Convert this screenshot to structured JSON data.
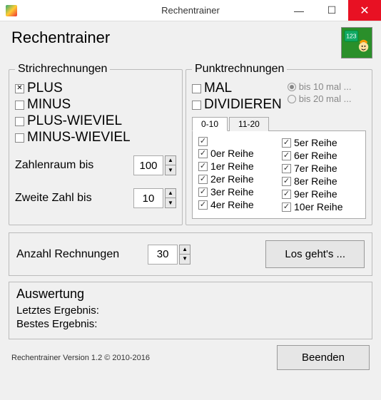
{
  "window": {
    "title": "Rechentrainer"
  },
  "header": {
    "title": "Rechentrainer"
  },
  "strich": {
    "legend": "Strichrechnungen",
    "items": [
      {
        "label": "PLUS",
        "checked": true
      },
      {
        "label": "MINUS",
        "checked": false
      },
      {
        "label": "PLUS-WIEVIEL",
        "checked": false
      },
      {
        "label": "MINUS-WIEVIEL",
        "checked": false
      }
    ],
    "range_label": "Zahlenraum bis",
    "range_value": "100",
    "second_label": "Zweite Zahl bis",
    "second_value": "10"
  },
  "punkt": {
    "legend": "Punktrechnungen",
    "ops": [
      {
        "label": "MAL",
        "checked": false
      },
      {
        "label": "DIVIDIEREN",
        "checked": false
      }
    ],
    "radios": [
      {
        "label": "bis 10 mal ...",
        "selected": true
      },
      {
        "label": "bis 20 mal ...",
        "selected": false
      }
    ],
    "tabs": [
      {
        "label": "0-10",
        "active": true
      },
      {
        "label": "11-20",
        "active": false
      }
    ],
    "reihen_left": [
      {
        "label": "",
        "checked": true
      },
      {
        "label": "0er Reihe",
        "checked": true
      },
      {
        "label": "1er Reihe",
        "checked": true
      },
      {
        "label": "2er Reihe",
        "checked": true
      },
      {
        "label": "3er Reihe",
        "checked": true
      },
      {
        "label": "4er Reihe",
        "checked": true
      }
    ],
    "reihen_right": [
      {
        "label": "5er Reihe",
        "checked": true
      },
      {
        "label": "6er Reihe",
        "checked": true
      },
      {
        "label": "7er Reihe",
        "checked": true
      },
      {
        "label": "8er Reihe",
        "checked": true
      },
      {
        "label": "9er Reihe",
        "checked": true
      },
      {
        "label": "10er Reihe",
        "checked": true
      }
    ]
  },
  "mid": {
    "count_label": "Anzahl Rechnungen",
    "count_value": "30",
    "start_label": "Los geht's ..."
  },
  "ausw": {
    "legend": "Auswertung",
    "last_label": "Letztes Ergebnis:",
    "best_label": "Bestes Ergebnis:"
  },
  "footer": {
    "version": "Rechentrainer Version 1.2 © 2010-2016",
    "quit_label": "Beenden"
  }
}
